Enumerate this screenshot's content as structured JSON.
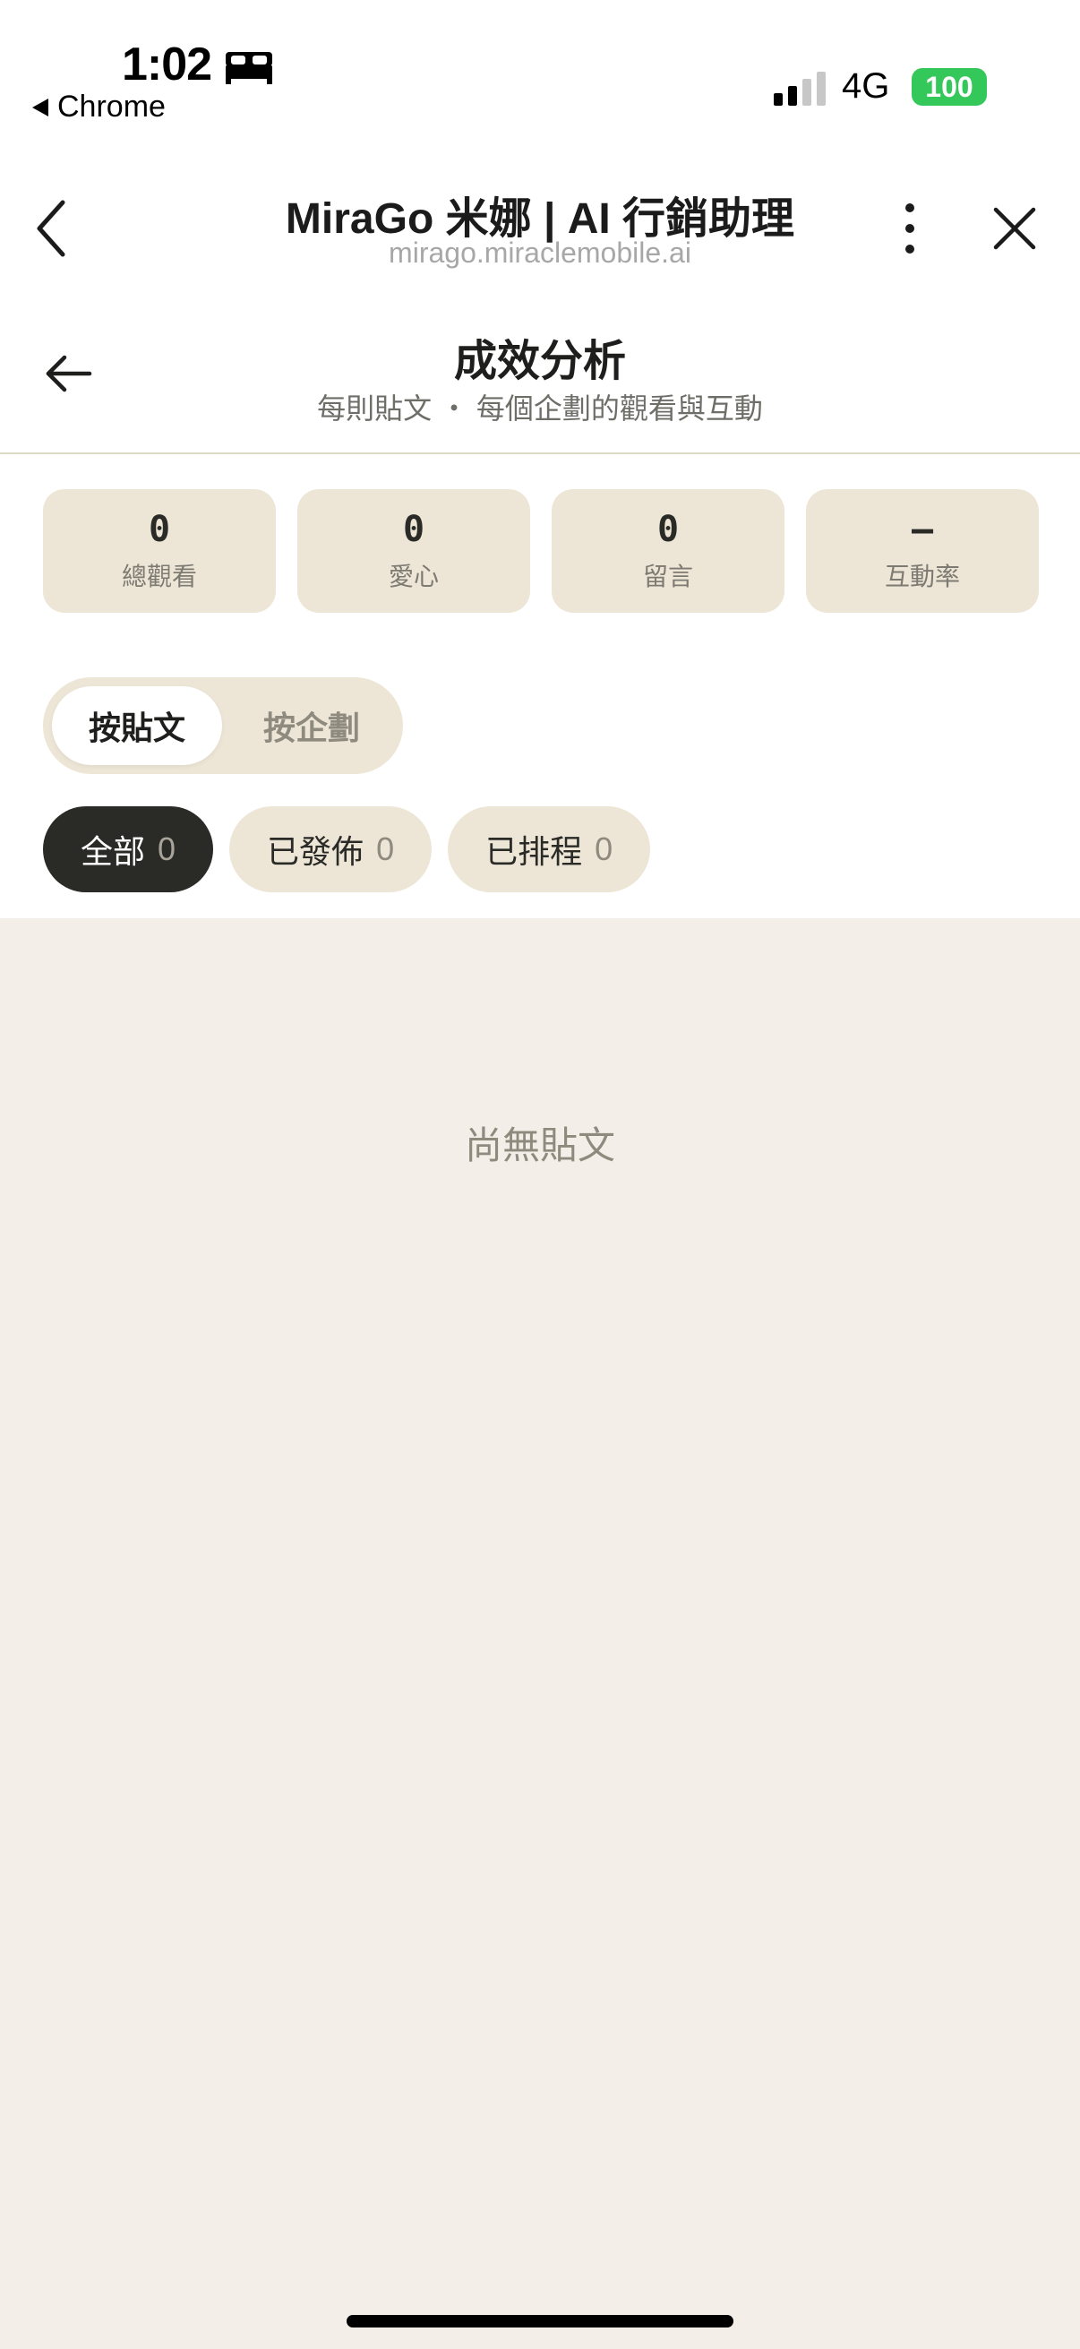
{
  "status_bar": {
    "time": "1:02",
    "back_app": "Chrome",
    "network": "4G",
    "battery": "100"
  },
  "browser": {
    "title": "MiraGo 米娜 | AI 行銷助理",
    "url": "mirago.miraclemobile.ai"
  },
  "page": {
    "title": "成效分析",
    "subtitle": "每則貼文 ・ 每個企劃的觀看與互動"
  },
  "stats": [
    {
      "value": "0",
      "label": "總觀看"
    },
    {
      "value": "0",
      "label": "愛心"
    },
    {
      "value": "0",
      "label": "留言"
    },
    {
      "value": "–",
      "label": "互動率"
    }
  ],
  "segmented": {
    "active": "按貼文",
    "inactive": "按企劃"
  },
  "filters": [
    {
      "label": "全部",
      "count": "0"
    },
    {
      "label": "已發佈",
      "count": "0"
    },
    {
      "label": "已排程",
      "count": "0"
    }
  ],
  "empty_state": "尚無貼文",
  "colors": {
    "accent_dark": "#2a2a27",
    "chip_bg": "#ede6d7",
    "content_bg": "#f3efe8",
    "battery": "#34c759"
  },
  "icons": {
    "bed": "bed-icon",
    "browser_back": "chevron-left-icon",
    "more": "more-vertical-icon",
    "close": "close-icon",
    "page_back": "arrow-left-icon"
  }
}
